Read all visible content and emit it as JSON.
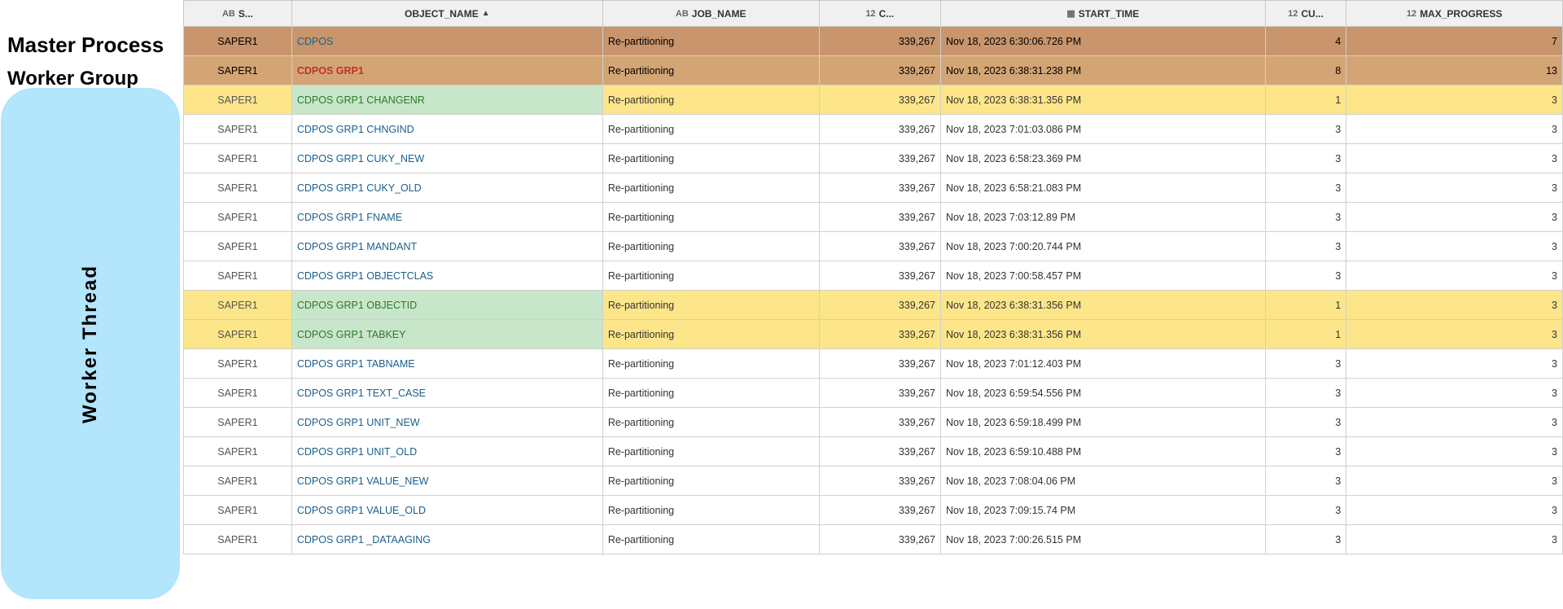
{
  "labels": {
    "master_process": "Master Process",
    "worker_group": "Worker Group",
    "worker_thread": "Worker Thread"
  },
  "columns": [
    {
      "id": "s",
      "label": "S...",
      "icon": "AB",
      "sort": false
    },
    {
      "id": "obj",
      "label": "OBJECT_NAME",
      "icon": "",
      "sort": true
    },
    {
      "id": "job",
      "label": "JOB_NAME",
      "icon": "AB",
      "sort": false
    },
    {
      "id": "cnt",
      "label": "C...",
      "icon": "12",
      "sort": false
    },
    {
      "id": "start",
      "label": "START_TIME",
      "icon": "table",
      "sort": false
    },
    {
      "id": "cu",
      "label": "CU...",
      "icon": "12",
      "sort": false
    },
    {
      "id": "max",
      "label": "MAX_PROGRESS",
      "icon": "12",
      "sort": false
    }
  ],
  "rows": [
    {
      "type": "master",
      "s": "SAPER1",
      "obj": "CDPOS",
      "job": "Re-partitioning",
      "cnt": "339,267",
      "start": "Nov 18, 2023 6:30:06.726 PM",
      "cu": "4",
      "max": "7"
    },
    {
      "type": "worker-group",
      "s": "SAPER1",
      "obj": "CDPOS GRP1",
      "job": "Re-partitioning",
      "cnt": "339,267",
      "start": "Nov 18, 2023 6:38:31.238 PM",
      "cu": "8",
      "max": "13"
    },
    {
      "type": "highlight",
      "s": "SAPER1",
      "obj": "CDPOS GRP1 CHANGENR",
      "job": "Re-partitioning",
      "cnt": "339,267",
      "start": "Nov 18, 2023 6:38:31.356 PM",
      "cu": "1",
      "max": "3"
    },
    {
      "type": "normal",
      "s": "SAPER1",
      "obj": "CDPOS GRP1 CHNGIND",
      "job": "Re-partitioning",
      "cnt": "339,267",
      "start": "Nov 18, 2023 7:01:03.086 PM",
      "cu": "3",
      "max": "3"
    },
    {
      "type": "normal",
      "s": "SAPER1",
      "obj": "CDPOS GRP1 CUKY_NEW",
      "job": "Re-partitioning",
      "cnt": "339,267",
      "start": "Nov 18, 2023 6:58:23.369 PM",
      "cu": "3",
      "max": "3"
    },
    {
      "type": "normal",
      "s": "SAPER1",
      "obj": "CDPOS GRP1 CUKY_OLD",
      "job": "Re-partitioning",
      "cnt": "339,267",
      "start": "Nov 18, 2023 6:58:21.083 PM",
      "cu": "3",
      "max": "3"
    },
    {
      "type": "normal",
      "s": "SAPER1",
      "obj": "CDPOS GRP1 FNAME",
      "job": "Re-partitioning",
      "cnt": "339,267",
      "start": "Nov 18, 2023 7:03:12.89 PM",
      "cu": "3",
      "max": "3"
    },
    {
      "type": "normal",
      "s": "SAPER1",
      "obj": "CDPOS GRP1 MANDANT",
      "job": "Re-partitioning",
      "cnt": "339,267",
      "start": "Nov 18, 2023 7:00:20.744 PM",
      "cu": "3",
      "max": "3"
    },
    {
      "type": "normal",
      "s": "SAPER1",
      "obj": "CDPOS GRP1 OBJECTCLAS",
      "job": "Re-partitioning",
      "cnt": "339,267",
      "start": "Nov 18, 2023 7:00:58.457 PM",
      "cu": "3",
      "max": "3"
    },
    {
      "type": "highlight",
      "s": "SAPER1",
      "obj": "CDPOS GRP1 OBJECTID",
      "job": "Re-partitioning",
      "cnt": "339,267",
      "start": "Nov 18, 2023 6:38:31.356 PM",
      "cu": "1",
      "max": "3"
    },
    {
      "type": "highlight",
      "s": "SAPER1",
      "obj": "CDPOS GRP1 TABKEY",
      "job": "Re-partitioning",
      "cnt": "339,267",
      "start": "Nov 18, 2023 6:38:31.356 PM",
      "cu": "1",
      "max": "3"
    },
    {
      "type": "normal",
      "s": "SAPER1",
      "obj": "CDPOS GRP1 TABNAME",
      "job": "Re-partitioning",
      "cnt": "339,267",
      "start": "Nov 18, 2023 7:01:12.403 PM",
      "cu": "3",
      "max": "3"
    },
    {
      "type": "normal",
      "s": "SAPER1",
      "obj": "CDPOS GRP1 TEXT_CASE",
      "job": "Re-partitioning",
      "cnt": "339,267",
      "start": "Nov 18, 2023 6:59:54.556 PM",
      "cu": "3",
      "max": "3"
    },
    {
      "type": "normal",
      "s": "SAPER1",
      "obj": "CDPOS GRP1 UNIT_NEW",
      "job": "Re-partitioning",
      "cnt": "339,267",
      "start": "Nov 18, 2023 6:59:18.499 PM",
      "cu": "3",
      "max": "3"
    },
    {
      "type": "normal",
      "s": "SAPER1",
      "obj": "CDPOS GRP1 UNIT_OLD",
      "job": "Re-partitioning",
      "cnt": "339,267",
      "start": "Nov 18, 2023 6:59:10.488 PM",
      "cu": "3",
      "max": "3"
    },
    {
      "type": "normal",
      "s": "SAPER1",
      "obj": "CDPOS GRP1 VALUE_NEW",
      "job": "Re-partitioning",
      "cnt": "339,267",
      "start": "Nov 18, 2023 7:08:04.06 PM",
      "cu": "3",
      "max": "3"
    },
    {
      "type": "normal",
      "s": "SAPER1",
      "obj": "CDPOS GRP1 VALUE_OLD",
      "job": "Re-partitioning",
      "cnt": "339,267",
      "start": "Nov 18, 2023 7:09:15.74 PM",
      "cu": "3",
      "max": "3"
    },
    {
      "type": "normal",
      "s": "SAPER1",
      "obj": "CDPOS GRP1 _DATAAGING",
      "job": "Re-partitioning",
      "cnt": "339,267",
      "start": "Nov 18, 2023 7:00:26.515 PM",
      "cu": "3",
      "max": "3"
    }
  ]
}
